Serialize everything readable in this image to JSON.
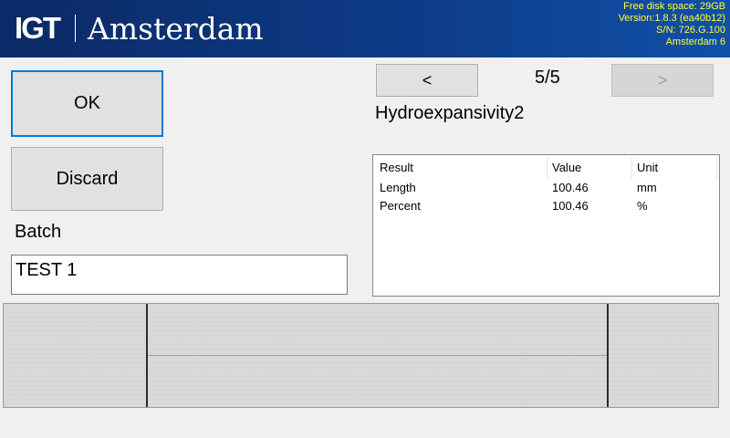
{
  "header": {
    "logo": "IGT",
    "app_name": "Amsterdam",
    "sysinfo": {
      "disk": "Free disk space: 29GB",
      "version": "Version:1.8.3 (ea40b12)",
      "serial": "S/N: 726.G.100",
      "device": "Amsterdam 6"
    }
  },
  "actions": {
    "ok_label": "OK",
    "discard_label": "Discard"
  },
  "batch": {
    "label": "Batch",
    "value": "TEST 1"
  },
  "navigation": {
    "prev_label": "<",
    "next_label": ">",
    "counter": "5/5",
    "next_enabled": false
  },
  "test_name": "Hydroexpansivity2",
  "results": {
    "headers": [
      "Result",
      "Value",
      "Unit"
    ],
    "rows": [
      [
        "Length",
        "100.46",
        "mm"
      ],
      [
        "Percent",
        "100.46",
        "%"
      ]
    ]
  },
  "colors": {
    "header_bg": "#0d3a86",
    "sysinfo_text": "#ffff33",
    "focus_border": "#0078d7"
  }
}
